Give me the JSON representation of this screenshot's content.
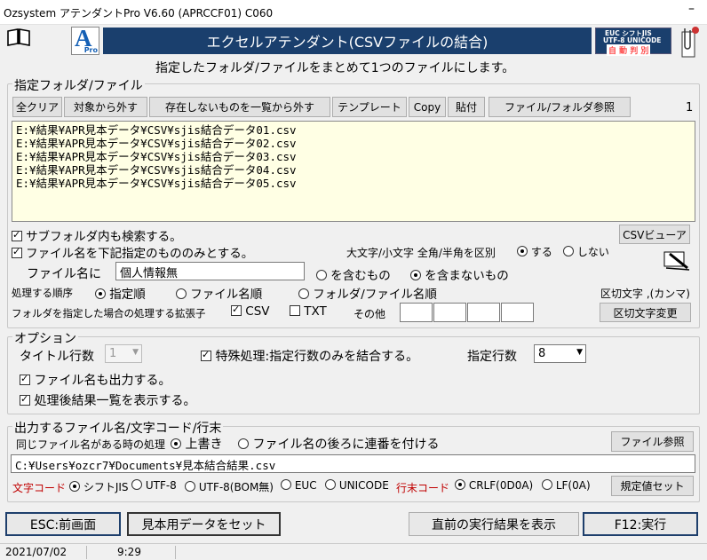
{
  "window": {
    "title": "Ozsystem アテンダントPro V6.60 (APRCCF01)  C060",
    "minimize": "–"
  },
  "header": {
    "logo_letter": "A",
    "logo_sub": "Pro",
    "banner": "エクセルアテンダント(CSVファイルの結合)",
    "encoding_badge_line1": "EUC  シフトJIS",
    "encoding_badge_line2": "UTF-8 UNICODE",
    "encoding_badge_line3": "自 動 判 別",
    "subtitle": "指定したフォルダ/ファイルをまとめて1つのファイルにします。"
  },
  "folder_group": {
    "title": "指定フォルダ/ファイル",
    "buttons": {
      "clear_all": "全クリア",
      "remove": "対象から外す",
      "remove_missing": "存在しないものを一覧から外す",
      "template": "テンプレート",
      "copy": "Copy",
      "paste": "貼付",
      "browse": "ファイル/フォルダ参照"
    },
    "count": "1",
    "files": [
      "E:¥結果¥APR見本データ¥CSV¥sjis結合データ01.csv",
      "E:¥結果¥APR見本データ¥CSV¥sjis結合データ02.csv",
      "E:¥結果¥APR見本データ¥CSV¥sjis結合データ03.csv",
      "E:¥結果¥APR見本データ¥CSV¥sjis結合データ04.csv",
      "E:¥結果¥APR見本データ¥CSV¥sjis結合データ05.csv"
    ],
    "search_subfolders": "サブフォルダ内も検索する。",
    "csv_viewer": "CSVビューア",
    "filter_by_name": "ファイル名を下記指定のもののみとする。",
    "case_label": "大文字/小文字 全角/半角を区別",
    "case_yes": "する",
    "case_no": "しない",
    "filename_label": "ファイル名に",
    "filename_value": "個人情報無",
    "contains": "を含むもの",
    "not_contains": "を含まないもの",
    "order_label": "処理する順序",
    "order_specified": "指定順",
    "order_filename": "ファイル名順",
    "order_folder_file": "フォルダ/ファイル名順",
    "delimiter_label": "区切文字 ,(カンマ)",
    "ext_label": "フォルダを指定した場合の処理する拡張子",
    "ext_csv": "CSV",
    "ext_txt": "TXT",
    "ext_other": "その他",
    "delimiter_change": "区切文字変更"
  },
  "options_group": {
    "title": "オプション",
    "title_rows_label": "タイトル行数",
    "title_rows_value": "1",
    "special_label": "特殊処理:指定行数のみを結合する。",
    "rows_label": "指定行数",
    "rows_value": "8",
    "output_filename": "ファイル名も出力する。",
    "show_results": "処理後結果一覧を表示する。"
  },
  "output_group": {
    "title": "出力するファイル名/文字コード/行末",
    "same_name_label": "同じファイル名がある時の処理",
    "overwrite": "上書き",
    "append_number": "ファイル名の後ろに連番を付ける",
    "file_browse": "ファイル参照",
    "path_value": "C:¥Users¥ozcr7¥Documents¥見本結合結果.csv",
    "charcode_label": "文字コード",
    "sjis": "シフトJIS",
    "utf8": "UTF-8",
    "utf8bom": "UTF-8(BOM無)",
    "euc": "EUC",
    "unicode": "UNICODE",
    "eol_label": "行末コード",
    "crlf": "CRLF(0D0A)",
    "lf": "LF(0A)",
    "defaults": "規定値セット"
  },
  "footer": {
    "esc": "ESC:前画面",
    "sample": "見本用データをセット",
    "show_last": "直前の実行結果を表示",
    "run": "F12:実行"
  },
  "status": {
    "date": "2021/07/02",
    "time": "9:29"
  },
  "colors": {
    "banner_bg": "#1a3f6d",
    "badge_bg": "#1a3f6d",
    "red_label": "#c00000"
  }
}
